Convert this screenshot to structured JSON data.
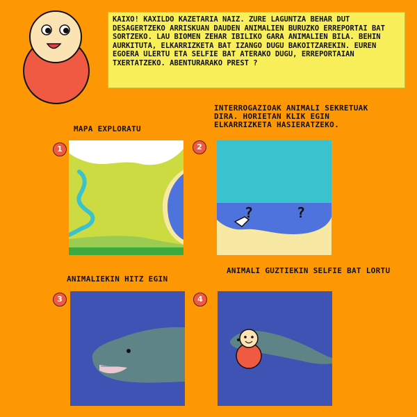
{
  "intro": {
    "speech": "KAIXO! KAXILDO KAZETARIA NAIZ. ZURE LAGUNTZA BEHAR DUT DESAGERTZEKO ARRISKUAN DAUDEN ANIMALIEN BURUZKO ERREPORTAI BAT SORTZEKO. LAU BIOMEN ZEHAR IBILIKO GARA ANIMALIEN BILA. BEHIN AURKITUTA, ELKARRIZKETA BAT IZANGO DUGU BAKOITZAREKIN. EUREN EGOERA ULERTU ETA SELFIE BAT ATERAKO DUGU, ERREPORTAIAN TXERTATZEKO. ABENTURARAKO PREST ?"
  },
  "steps": [
    {
      "number": "1",
      "title": "MAPA EXPLORATU"
    },
    {
      "number": "2",
      "title": "INTERROGAZIOAK ANIMALI SEKRETUAK DIRA. HORIETAN KLIK EGIN ELKARRIZKETA HASIERATZEKO."
    },
    {
      "number": "3",
      "title": "ANIMALIEKIN HITZ EGIN"
    },
    {
      "number": "4",
      "title": "ANIMALI GUZTIEKIN SELFIE BAT LORTU"
    }
  ],
  "panel2": {
    "marker": "?"
  },
  "colors": {
    "background": "#fd9703",
    "speech_bubble": "#f8ef5a",
    "badge": "#f15a42",
    "sea": "#4f73dc",
    "water_teal": "#3bc2cf",
    "sand": "#f7e8a3",
    "grass": "#cddb42",
    "deep_sea": "#3e53b3",
    "animal": "#5f8488"
  },
  "icons": [
    "character-avatar-icon",
    "cursor-hand-icon",
    "question-mark-icon",
    "whale-icon",
    "seal-icon"
  ]
}
